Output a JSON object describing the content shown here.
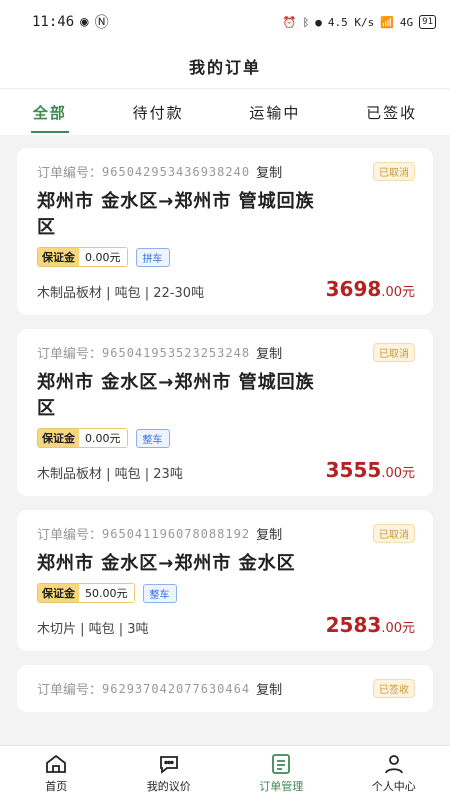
{
  "status_bar": {
    "time": "11:46",
    "network": "4.5 K/s",
    "signal": "4G",
    "battery": "91"
  },
  "header": {
    "title": "我的订单"
  },
  "tabs": [
    {
      "label": "全部",
      "active": true
    },
    {
      "label": "待付款",
      "active": false
    },
    {
      "label": "运输中",
      "active": false
    },
    {
      "label": "已签收",
      "active": false
    }
  ],
  "orders": [
    {
      "order_label": "订单编号：",
      "order_no": "965042953436938240",
      "copy": "复制",
      "status": "已取消",
      "route_line1": "郑州市 金水区→郑州市  管城回族",
      "route_line2": "区",
      "deposit_label": "保证金",
      "deposit": "0.00元",
      "mode": "拼车",
      "goods": "木制品板材 | 吨包 | 22-30吨",
      "price_int": "3698",
      "price_dec": ".00元"
    },
    {
      "order_label": "订单编号：",
      "order_no": "965041953523253248",
      "copy": "复制",
      "status": "已取消",
      "route_line1": "郑州市 金水区→郑州市  管城回族",
      "route_line2": "区",
      "deposit_label": "保证金",
      "deposit": "0.00元",
      "mode": "整车",
      "goods": "木制品板材 | 吨包 | 23吨",
      "price_int": "3555",
      "price_dec": ".00元"
    },
    {
      "order_label": "订单编号：",
      "order_no": "965041196078088192",
      "copy": "复制",
      "status": "已取消",
      "route_line1": "郑州市 金水区→郑州市  金水区",
      "route_line2": "",
      "deposit_label": "保证金",
      "deposit": "50.00元",
      "mode": "整车",
      "goods": "木切片 | 吨包 | 3吨",
      "price_int": "2583",
      "price_dec": ".00元"
    },
    {
      "order_label": "订单编号：",
      "order_no": "962937042077630464",
      "copy": "复制",
      "status": "已签收",
      "route_line1": "",
      "route_line2": "",
      "deposit_label": "",
      "deposit": "",
      "mode": "",
      "goods": "",
      "price_int": "",
      "price_dec": ""
    }
  ],
  "nav": [
    {
      "label": "首页",
      "icon": "home-icon"
    },
    {
      "label": "我的议价",
      "icon": "chat-icon"
    },
    {
      "label": "订单管理",
      "icon": "order-icon",
      "active": true
    },
    {
      "label": "个人中心",
      "icon": "user-icon"
    }
  ],
  "colors": {
    "accent": "#3d8a52",
    "price": "#b42222",
    "deposit": "#f7d77e"
  }
}
